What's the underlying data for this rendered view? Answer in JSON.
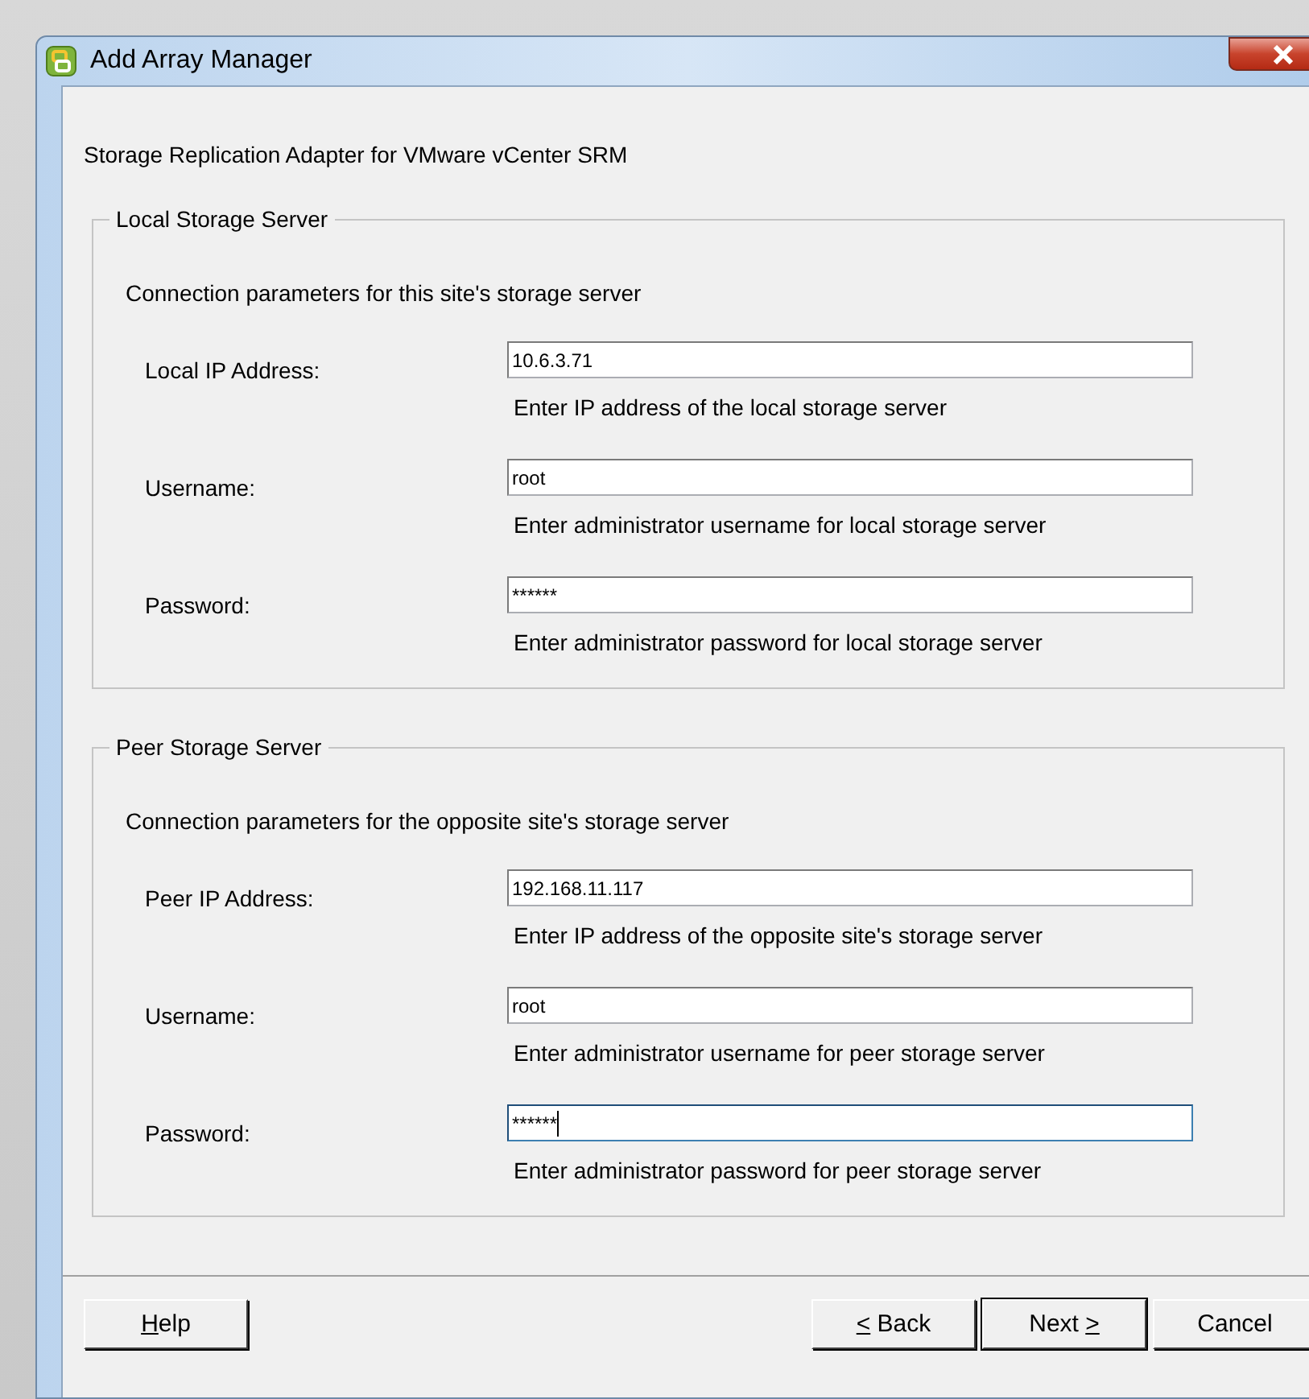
{
  "window": {
    "title": "Add Array Manager"
  },
  "subtitle": "Storage Replication Adapter for VMware vCenter SRM",
  "groups": [
    {
      "title": "Local Storage Server",
      "description": "Connection parameters for this site's storage server",
      "fields": [
        {
          "label": "Local IP Address:",
          "value": "10.6.3.71",
          "hint": "Enter IP address of the local storage server",
          "focused": false
        },
        {
          "label": "Username:",
          "value": "root",
          "hint": "Enter administrator username for local storage server",
          "focused": false
        },
        {
          "label": "Password:",
          "value": "******",
          "hint": "Enter administrator password for local storage server",
          "focused": false
        }
      ]
    },
    {
      "title": "Peer Storage Server",
      "description": "Connection parameters for the opposite site's storage server",
      "fields": [
        {
          "label": "Peer IP Address:",
          "value": "192.168.11.117",
          "hint": "Enter IP address of the opposite site's storage server",
          "focused": false
        },
        {
          "label": "Username:",
          "value": "root",
          "hint": "Enter administrator username for peer storage server",
          "focused": false
        },
        {
          "label": "Password:",
          "value": "******",
          "hint": "Enter administrator password for peer storage server",
          "focused": true
        }
      ]
    }
  ],
  "left_buttons": [
    {
      "key": "H",
      "after": "elp",
      "default": false
    }
  ],
  "right_buttons": [
    {
      "key": "<",
      "after": " Back",
      "default": false
    },
    {
      "before": "Next ",
      "key": ">",
      "default": true
    },
    {
      "before": "Cancel",
      "default": false
    }
  ]
}
